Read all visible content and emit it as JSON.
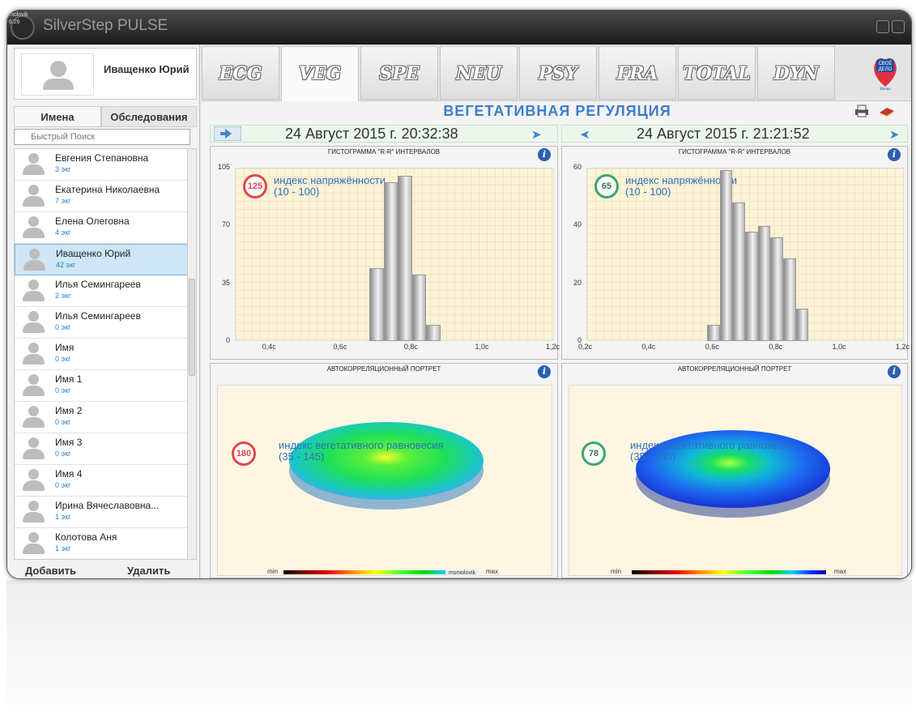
{
  "window": {
    "title": "SilverStep PULSE",
    "overlay_user": "molovik",
    "overlay_time": "6:26"
  },
  "profile": {
    "name": "Иващенко Юрий"
  },
  "left_tabs": {
    "names": "Имена",
    "exams": "Обследования"
  },
  "search": {
    "placeholder": "Быстрый Поиск"
  },
  "patients": [
    {
      "name": "Евгения Степановна",
      "count": "3 экг"
    },
    {
      "name": "Екатерина Николаевна",
      "count": "7 экг"
    },
    {
      "name": "Елена Олеговна",
      "count": "4 экг"
    },
    {
      "name": "Иващенко Юрий",
      "count": "42 экг",
      "selected": true
    },
    {
      "name": "Илья Семингареев",
      "count": "2 экг"
    },
    {
      "name": "Илья Семингареев",
      "count": "0 экг"
    },
    {
      "name": "Имя",
      "count": "0 экг"
    },
    {
      "name": "Имя 1",
      "count": "0 экг"
    },
    {
      "name": "Имя 2",
      "count": "0 экг"
    },
    {
      "name": "Имя 3",
      "count": "0 экг"
    },
    {
      "name": "Имя 4",
      "count": "0 экг"
    },
    {
      "name": "Ирина Вячеславовна...",
      "count": "1 экг"
    },
    {
      "name": "Колотова Аня",
      "count": "1 экг"
    }
  ],
  "buttons": {
    "add": "Добавить",
    "delete": "Удалить"
  },
  "tabs": [
    "ECG",
    "VEG",
    "SPE",
    "NEU",
    "PSY",
    "FRA",
    "TOTAL",
    "DYN"
  ],
  "active_tab": "VEG",
  "brand": {
    "text_top": "СВОЁ",
    "text_mid": "ДЕЛО",
    "text_bottom": "Начни"
  },
  "section_title": "ВЕГЕТАТИВНАЯ РЕГУЛЯЦИЯ",
  "dates": {
    "left": "24 Август 2015 г. 20:32:38",
    "right": "24 Август 2015 г. 21:21:52"
  },
  "histogram_title": "ГИСТОГРАММА \"R-R\" ИНТЕРВАЛОВ",
  "autocorr_title": "АВТОКОРРЕЛЯЦИОННЫЙ ПОРТРЕТ",
  "tension_label_1": "индекс напряжённости",
  "tension_label_2": "(10 - 100)",
  "balance_label_1": "индекс вегетативного равновесия",
  "balance_label_2": "(35 - 145)",
  "scale": {
    "min": "min",
    "max": "max"
  },
  "colors": {
    "red_index": "#e04848",
    "green_index": "#3aa86a",
    "title_blue": "#3a7fc8"
  },
  "chart_data": [
    {
      "type": "bar",
      "title": "ГИСТОГРАММА \"R-R\" ИНТЕРВАЛОВ",
      "index_value": "125",
      "ylim": [
        0,
        105
      ],
      "yticks": [
        "0",
        "35",
        "70",
        "105"
      ],
      "xticks": [
        "0,4с",
        "0,6с",
        "0,8с",
        "1,0с",
        "1,2с"
      ],
      "xlim": [
        0.3,
        1.2
      ],
      "bins": [
        {
          "x0": 0.68,
          "x1": 0.72,
          "value": 44
        },
        {
          "x0": 0.72,
          "x1": 0.76,
          "value": 96
        },
        {
          "x0": 0.76,
          "x1": 0.8,
          "value": 100
        },
        {
          "x0": 0.8,
          "x1": 0.84,
          "value": 40
        },
        {
          "x0": 0.84,
          "x1": 0.88,
          "value": 10
        }
      ]
    },
    {
      "type": "bar",
      "title": "ГИСТОГРАММА \"R-R\" ИНТЕРВАЛОВ",
      "index_value": "65",
      "ylim": [
        0,
        65
      ],
      "yticks": [
        "0",
        "20",
        "40",
        "60"
      ],
      "xticks": [
        "0,2с",
        "0,4с",
        "0,6с",
        "0,8с",
        "1,0с",
        "1,2с"
      ],
      "xlim": [
        0.2,
        1.2
      ],
      "bins": [
        {
          "x0": 0.58,
          "x1": 0.62,
          "value": 6
        },
        {
          "x0": 0.62,
          "x1": 0.66,
          "value": 64
        },
        {
          "x0": 0.66,
          "x1": 0.7,
          "value": 52
        },
        {
          "x0": 0.7,
          "x1": 0.74,
          "value": 41
        },
        {
          "x0": 0.74,
          "x1": 0.78,
          "value": 43
        },
        {
          "x0": 0.78,
          "x1": 0.82,
          "value": 39
        },
        {
          "x0": 0.82,
          "x1": 0.86,
          "value": 31
        },
        {
          "x0": 0.86,
          "x1": 0.9,
          "value": 12
        }
      ]
    }
  ],
  "autocorr": [
    {
      "index_value": "180",
      "palette": "green"
    },
    {
      "index_value": "78",
      "palette": "blue"
    }
  ],
  "watermark_user": "msmolovik"
}
